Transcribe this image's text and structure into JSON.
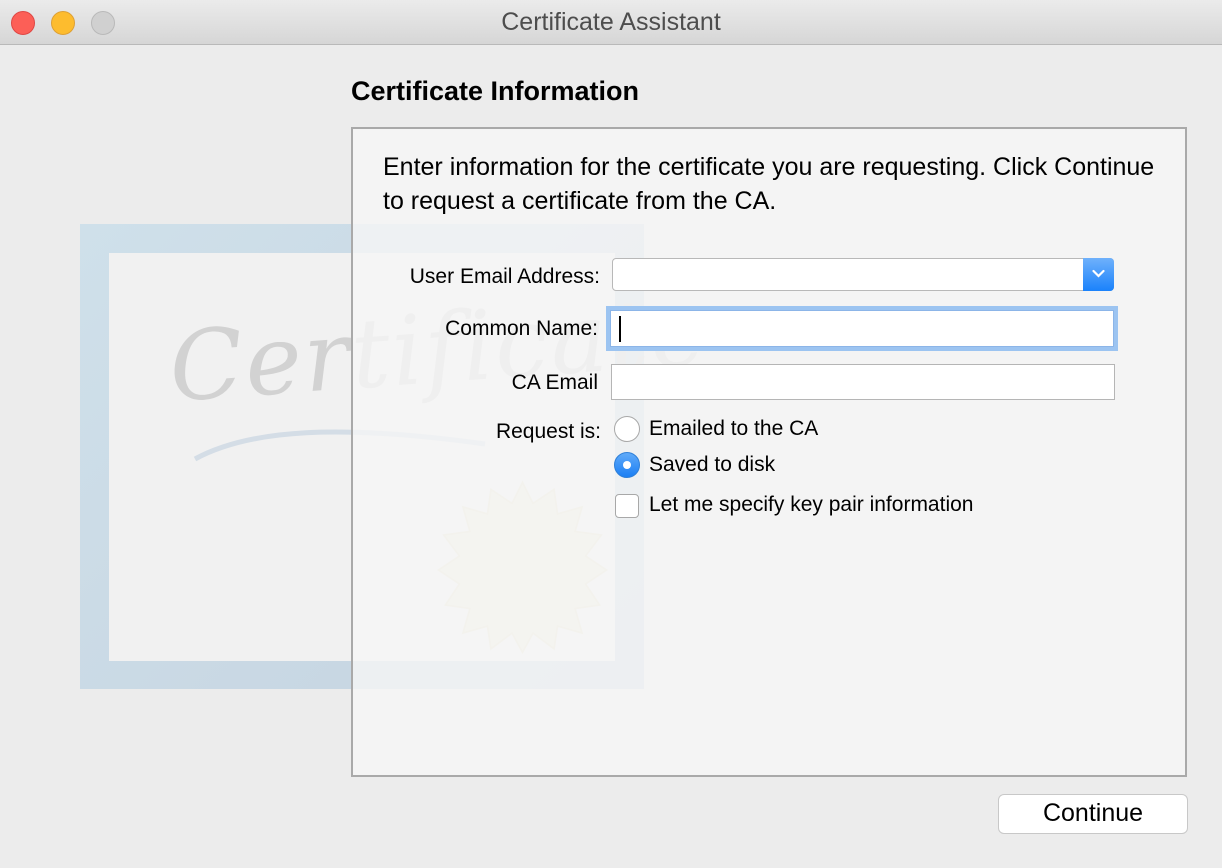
{
  "window": {
    "title": "Certificate Assistant",
    "controls": [
      "close",
      "minimize",
      "zoom"
    ]
  },
  "background_graphic": {
    "icon": "certificate-illustration"
  },
  "section": {
    "heading": "Certificate Information",
    "intro": "Enter information for the certificate you are requesting. Click Continue to request a certificate from the CA."
  },
  "form": {
    "user_email": {
      "label": "User Email Address:",
      "value": ""
    },
    "common_name": {
      "label": "Common Name:",
      "value": ""
    },
    "ca_email": {
      "label": "CA Email",
      "value": ""
    },
    "request": {
      "label": "Request is:",
      "options": [
        {
          "label": "Emailed to the CA",
          "selected": false
        },
        {
          "label": "Saved to disk",
          "selected": true
        }
      ]
    },
    "key_pair": {
      "label": "Let me specify key pair information",
      "checked": false
    }
  },
  "footer": {
    "continue_label": "Continue"
  },
  "colors": {
    "accent": "#1a82fb",
    "focus_ring": "#9cc4f1",
    "close": "#fc5f57",
    "minimize": "#fdbc2e"
  }
}
